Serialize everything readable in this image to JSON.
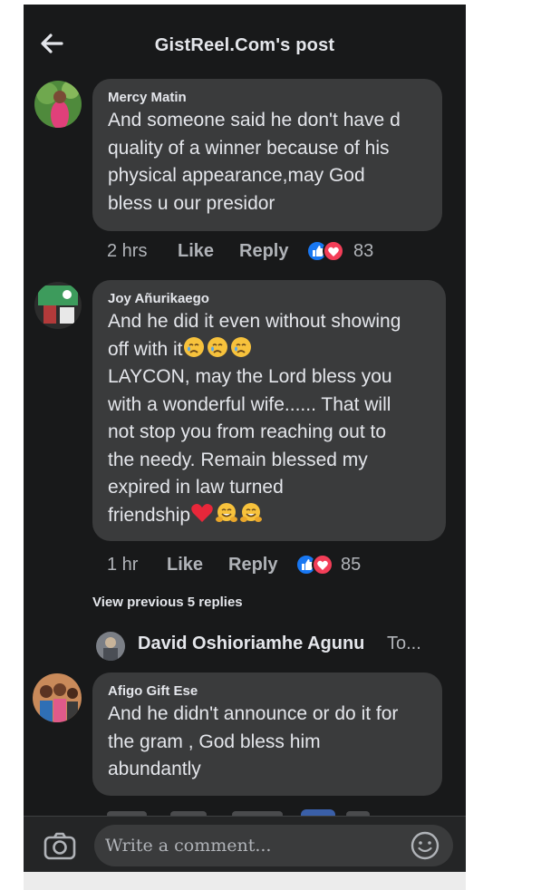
{
  "header": {
    "title": "GistReel.Com's post",
    "back_icon": "arrow-left-icon"
  },
  "comments": [
    {
      "author": "Mercy Matin",
      "text": "And someone said he don't have d\nquality of a winner because of his\nphysical appearance,may God\nbless u our presidor",
      "time": "2 hrs",
      "like": "Like",
      "reply": "Reply",
      "reactions": "83"
    },
    {
      "author": "Joy Añurikaego",
      "text_before": "And he did it even without showing\noff with it",
      "text_after": "\nLAYCON, may the Lord bless you\nwith a wonderful wife...... That will\nnot stop you from reaching out to\nthe needy. Remain blessed my\nexpired in law turned\nfriendship",
      "time": "1 hr",
      "like": "Like",
      "reply": "Reply",
      "reactions": "85"
    },
    {
      "author": "Afigo Gift Ese",
      "text": "And he didn't announce or do it for\nthe gram , God bless him\nabundantly"
    }
  ],
  "view_previous": "View previous 5 replies",
  "reply_preview": {
    "name": "David Oshioriamhe Agunu",
    "snippet": "To..."
  },
  "composer": {
    "placeholder": "Write a comment..."
  },
  "colors": {
    "background": "#18191a",
    "bubble": "#3a3b3c",
    "text": "#e4e6eb",
    "muted": "#b0b3b8",
    "like_blue": "#1877f2",
    "love_red": "#f33e58"
  }
}
